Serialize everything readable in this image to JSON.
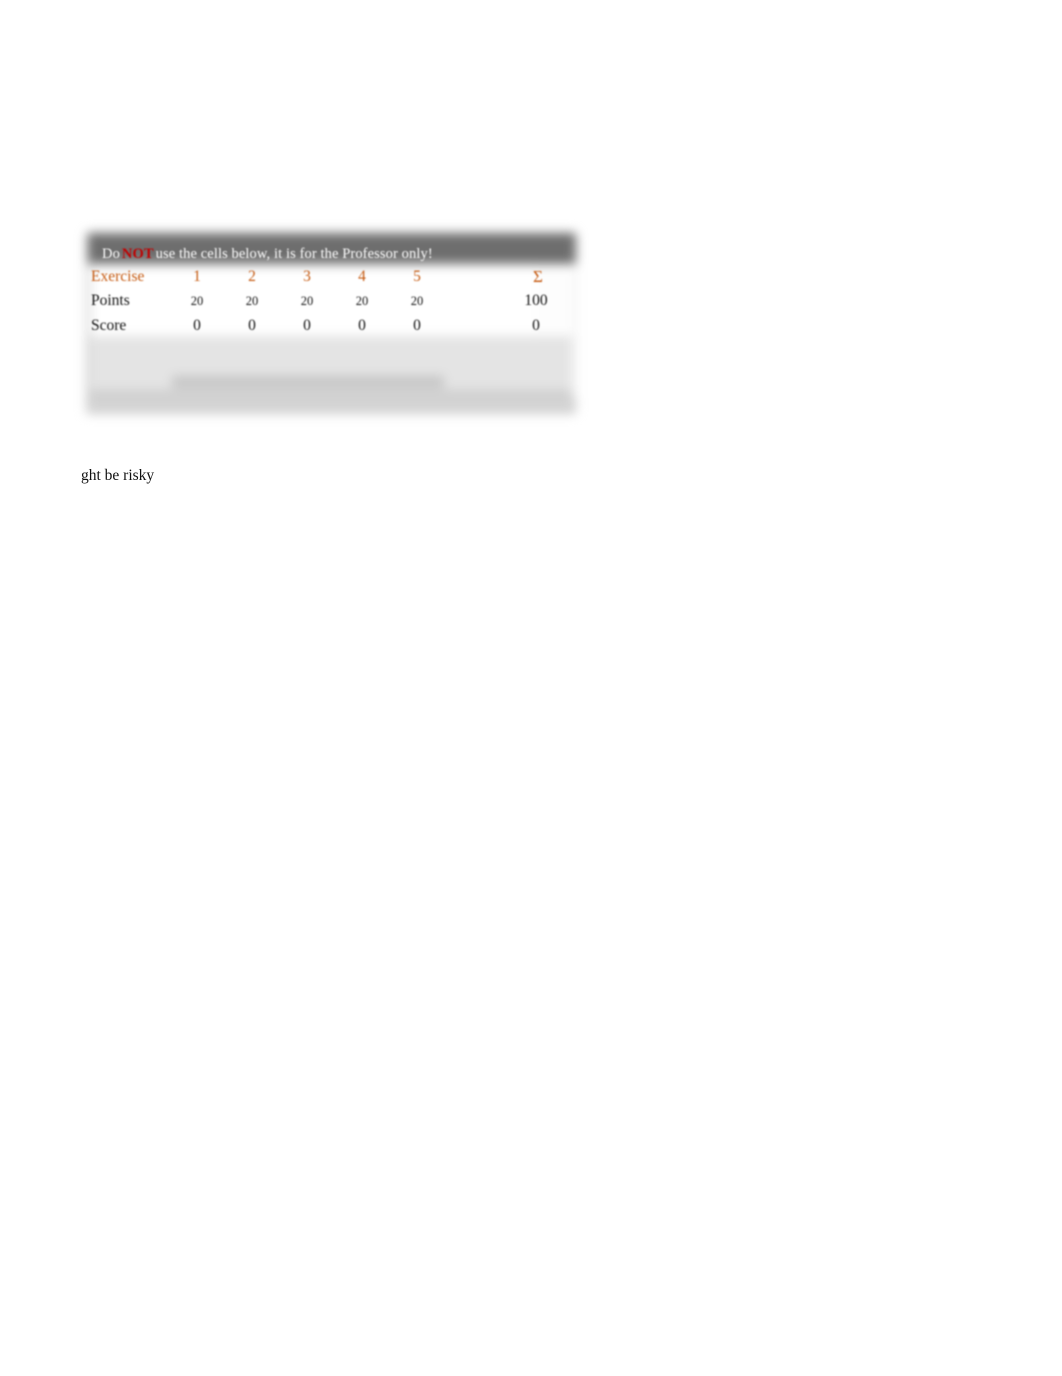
{
  "page": {
    "background_color": "#ffffff",
    "accent_color": "#C55A11",
    "warning_color": "#C00000",
    "header_band_color": "#6e6e6e"
  },
  "grading_table": {
    "notice": {
      "before": "Do",
      "emphasis": "NOT",
      "after": "use the cells below, it is for the Professor only!"
    },
    "row_labels": {
      "exercise": "Exercise",
      "points": "Points",
      "score": "Score"
    },
    "sum_symbol": "Σ",
    "columns": [
      {
        "header": "1",
        "points": "20",
        "score": "0"
      },
      {
        "header": "2",
        "points": "20",
        "score": "0"
      },
      {
        "header": "3",
        "points": "20",
        "score": "0"
      },
      {
        "header": "4",
        "points": "20",
        "score": "0"
      },
      {
        "header": "5",
        "points": "20",
        "score": "0"
      }
    ],
    "totals": {
      "points": "100",
      "score": "0"
    }
  },
  "caption": {
    "text": "ght be risky"
  }
}
